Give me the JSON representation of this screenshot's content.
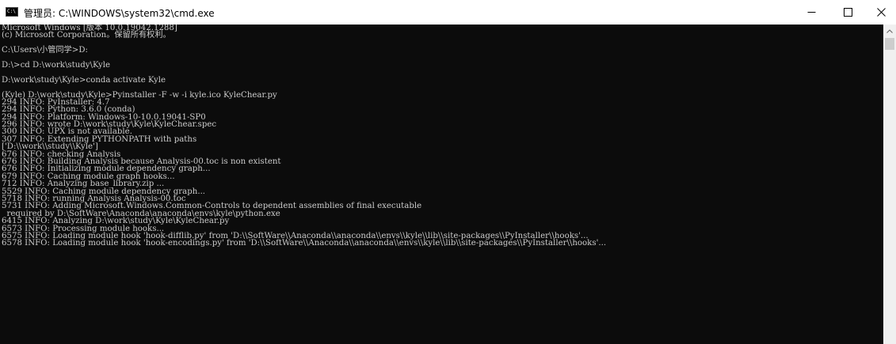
{
  "window": {
    "title": "管理员: C:\\WINDOWS\\system32\\cmd.exe",
    "app_icon_text": "C:\\",
    "buttons": {
      "minimize": "minimize",
      "maximize": "maximize",
      "close": "close"
    }
  },
  "console": {
    "text_color": "#cccccc",
    "background_color": "#0c0c0c",
    "lines": [
      "Microsoft Windows [版本 10.0.19042.1288]",
      "(c) Microsoft Corporation。保留所有权利。",
      "",
      "C:\\Users\\小管同学>D:",
      "",
      "D:\\>cd D:\\work\\study\\Kyle",
      "",
      "D:\\work\\study\\Kyle>conda activate Kyle",
      "",
      "(Kyle) D:\\work\\study\\Kyle>Pyinstaller -F -w -i kyle.ico KyleChear.py",
      "294 INFO: PyInstaller: 4.7",
      "294 INFO: Python: 3.6.0 (conda)",
      "294 INFO: Platform: Windows-10-10.0.19041-SP0",
      "296 INFO: wrote D:\\work\\study\\Kyle\\KyleChear.spec",
      "300 INFO: UPX is not available.",
      "307 INFO: Extending PYTHONPATH with paths",
      "['D:\\\\work\\\\study\\\\Kyle']",
      "676 INFO: checking Analysis",
      "676 INFO: Building Analysis because Analysis-00.toc is non existent",
      "676 INFO: Initializing module dependency graph...",
      "679 INFO: Caching module graph hooks...",
      "712 INFO: Analyzing base_library.zip ...",
      "5529 INFO: Caching module dependency graph...",
      "5718 INFO: running Analysis Analysis-00.toc",
      "5731 INFO: Adding Microsoft.Windows.Common-Controls to dependent assemblies of final executable",
      "  required by D:\\SoftWare\\Anaconda\\anaconda\\envs\\kyle\\python.exe",
      "6415 INFO: Analyzing D:\\work\\study\\Kyle\\KyleChear.py",
      "6573 INFO: Processing module hooks...",
      "6575 INFO: Loading module hook 'hook-difflib.py' from 'D:\\\\SoftWare\\\\Anaconda\\\\anaconda\\\\envs\\\\kyle\\\\lib\\\\site-packages\\\\PyInstaller\\\\hooks'...",
      "6578 INFO: Loading module hook 'hook-encodings.py' from 'D:\\\\SoftWare\\\\Anaconda\\\\anaconda\\\\envs\\\\kyle\\\\lib\\\\site-packages\\\\PyInstaller\\\\hooks'..."
    ]
  },
  "scrollbar": {
    "up_arrow_icon": "chevron-up-icon"
  }
}
